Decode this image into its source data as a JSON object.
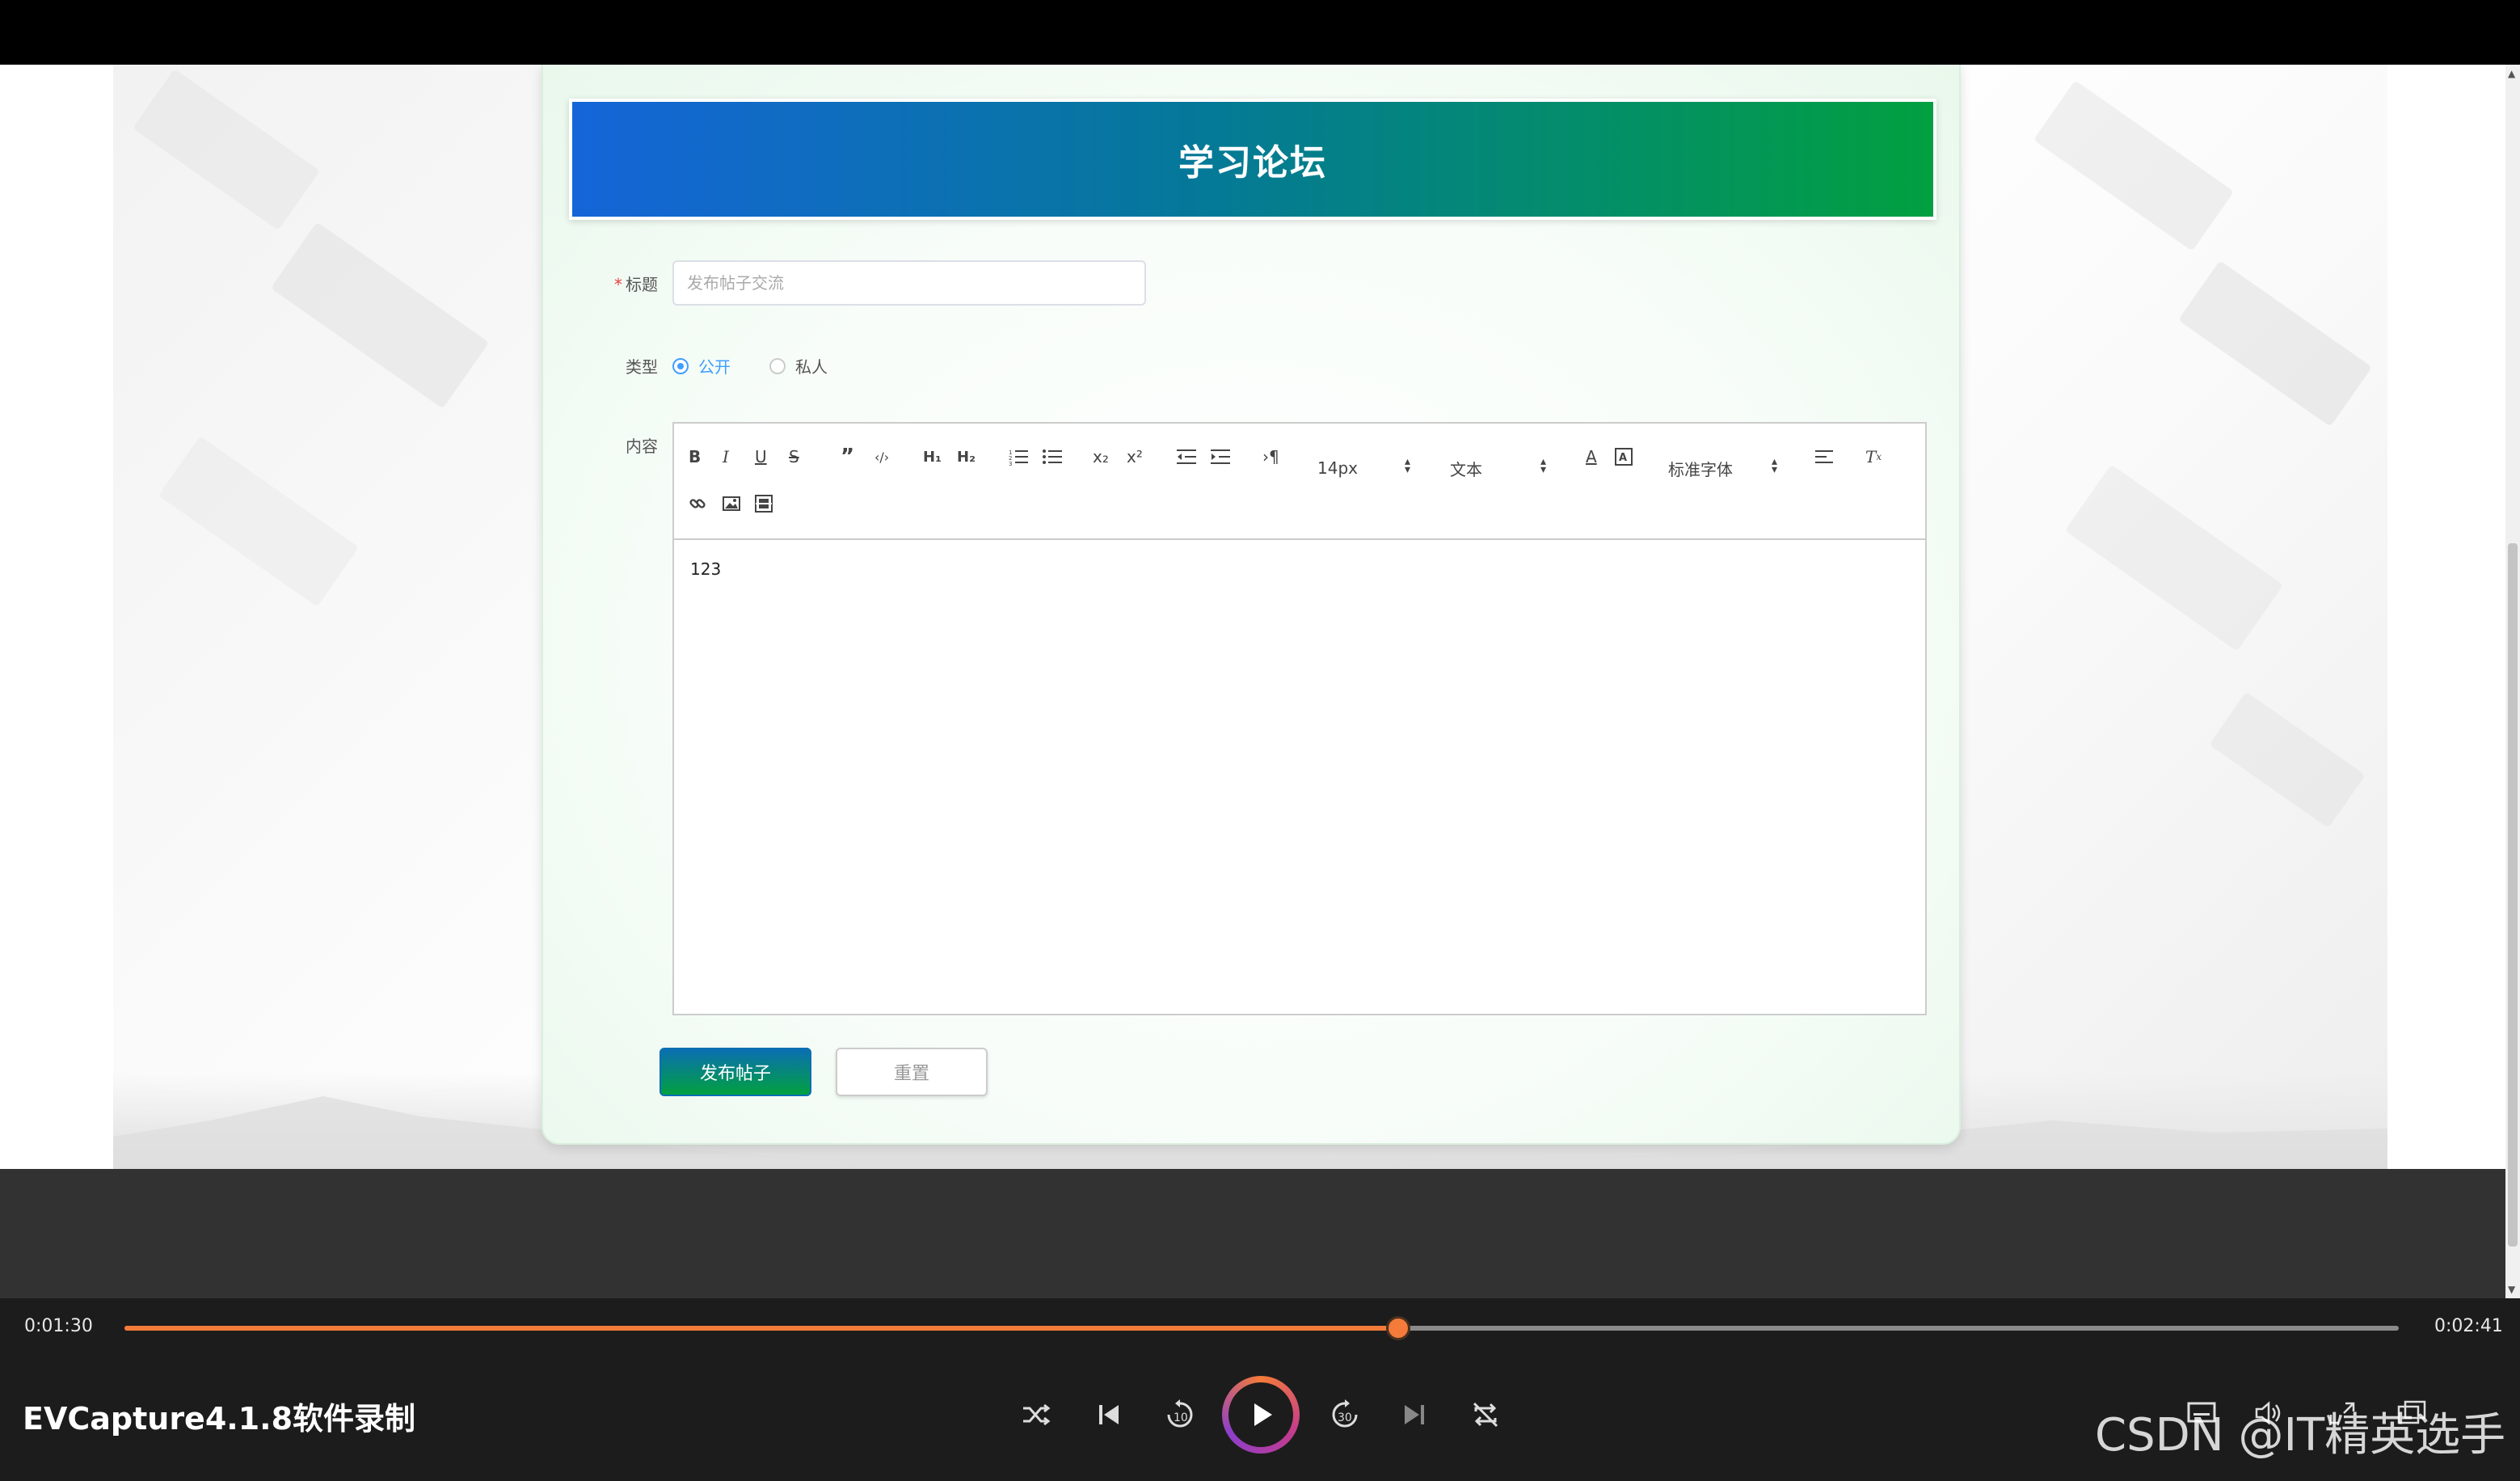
{
  "forum": {
    "banner_title": "学习论坛",
    "title_label": "标题",
    "title_required_mark": "*",
    "title_placeholder": "发布帖子交流",
    "type_label": "类型",
    "type_options": [
      {
        "label": "公开",
        "selected": true
      },
      {
        "label": "私人",
        "selected": false
      }
    ],
    "content_label": "内容",
    "editor": {
      "toolbar": {
        "font_size": "14px",
        "header_select": "文本",
        "font_family": "标准字体"
      },
      "content_text": "123"
    },
    "submit_label": "发布帖子",
    "reset_label": "重置"
  },
  "player": {
    "current_time": "0:01:30",
    "total_time": "0:02:41",
    "progress": 0.56,
    "app_name": "EVCapture4.1.8软件录制",
    "watermark": "CSDN @IT精英选手"
  },
  "colors": {
    "accent_blue": "#409eff",
    "banner_start": "#1565d8",
    "banner_end": "#02a040",
    "progress": "#f47b39",
    "required": "#e64141"
  }
}
